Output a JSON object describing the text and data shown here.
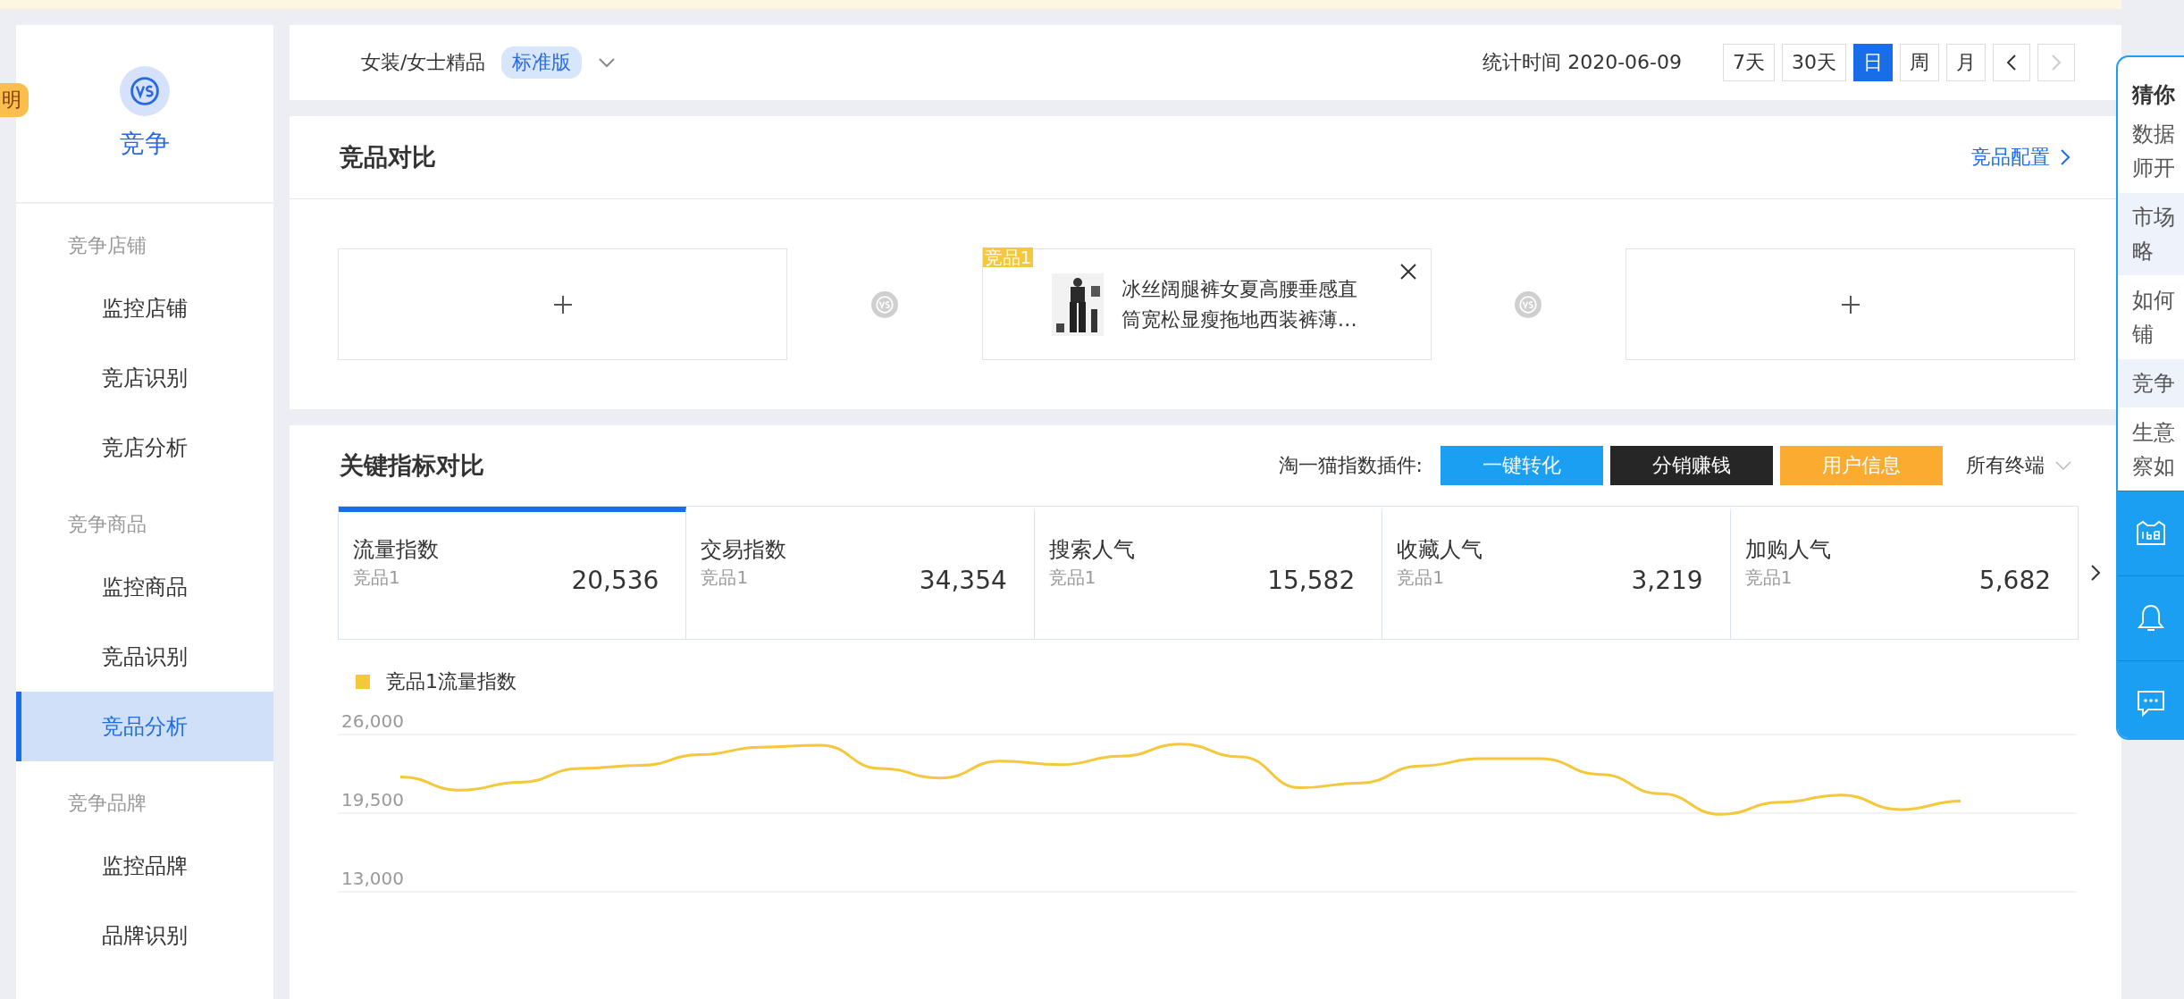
{
  "side_badge": {
    "label": "明"
  },
  "sidebar": {
    "title": "竞争",
    "groups": [
      {
        "label": "竞争店铺",
        "items": [
          {
            "label": "监控店铺",
            "selected": false
          },
          {
            "label": "竞店识别",
            "selected": false
          },
          {
            "label": "竞店分析",
            "selected": false
          }
        ]
      },
      {
        "label": "竞争商品",
        "items": [
          {
            "label": "监控商品",
            "selected": false
          },
          {
            "label": "竞品识别",
            "selected": false
          },
          {
            "label": "竞品分析",
            "selected": true
          }
        ]
      },
      {
        "label": "竞争品牌",
        "items": [
          {
            "label": "监控品牌",
            "selected": false
          },
          {
            "label": "品牌识别",
            "selected": false
          }
        ]
      }
    ]
  },
  "topbar": {
    "category": "女装/女士精品",
    "edition": "标准版",
    "stat_label": "统计时间",
    "stat_date": "2020-06-09",
    "periods": [
      {
        "label": "7天",
        "selected": false
      },
      {
        "label": "30天",
        "selected": false
      },
      {
        "label": "日",
        "selected": true
      },
      {
        "label": "周",
        "selected": false
      },
      {
        "label": "月",
        "selected": false
      }
    ],
    "prev": {
      "disabled": false
    },
    "next": {
      "disabled": true
    }
  },
  "compare": {
    "title": "竞品对比",
    "config_link": "竞品配置",
    "slots": [
      {
        "kind": "empty"
      },
      {
        "kind": "product",
        "tag": "竞品1",
        "title": "冰丝阔腿裤女夏高腰垂感直筒宽松显瘦拖地西装裤薄…"
      },
      {
        "kind": "empty"
      }
    ]
  },
  "metrics": {
    "title": "关键指标对比",
    "plugin_label": "淘一猫指数插件:",
    "plugins": [
      {
        "label": "一键转化",
        "color": "#1a9ff2"
      },
      {
        "label": "分销赚钱",
        "color": "#262626"
      },
      {
        "label": "用户信息",
        "color": "#fbab2f"
      }
    ],
    "terminal": "所有终端",
    "tabs": [
      {
        "name": "流量指数",
        "sub": "竞品1",
        "value": "20,536",
        "selected": true
      },
      {
        "name": "交易指数",
        "sub": "竞品1",
        "value": "34,354",
        "selected": false
      },
      {
        "name": "搜索人气",
        "sub": "竞品1",
        "value": "15,582",
        "selected": false
      },
      {
        "name": "收藏人气",
        "sub": "竞品1",
        "value": "3,219",
        "selected": false
      },
      {
        "name": "加购人气",
        "sub": "竞品1",
        "value": "5,682",
        "selected": false
      }
    ],
    "chart_data": {
      "type": "line",
      "ylim": [
        13000,
        26000
      ],
      "yticks": [
        {
          "value": 13000,
          "label": "13,000"
        },
        {
          "value": 19500,
          "label": "19,500"
        },
        {
          "value": 26000,
          "label": "26,000"
        }
      ],
      "series": [
        {
          "name": "竞品1流量指数",
          "color": "#f5c73a",
          "values": [
            22500,
            21400,
            22050,
            23200,
            23450,
            24330,
            24950,
            25120,
            23200,
            22400,
            23800,
            23500,
            24200,
            25200,
            24150,
            21600,
            22000,
            23400,
            24000,
            24000,
            22700,
            21100,
            19400,
            20400,
            21000,
            19800,
            20500
          ]
        }
      ]
    }
  },
  "help": {
    "title": "猜你",
    "items": [
      {
        "lines": [
          "数据",
          "师开"
        ]
      },
      {
        "lines": [
          "市场",
          "略"
        ]
      },
      {
        "lines": [
          "如何",
          "铺"
        ]
      },
      {
        "lines": [
          "竞争"
        ]
      },
      {
        "lines": [
          "生意",
          "察如"
        ]
      }
    ]
  }
}
